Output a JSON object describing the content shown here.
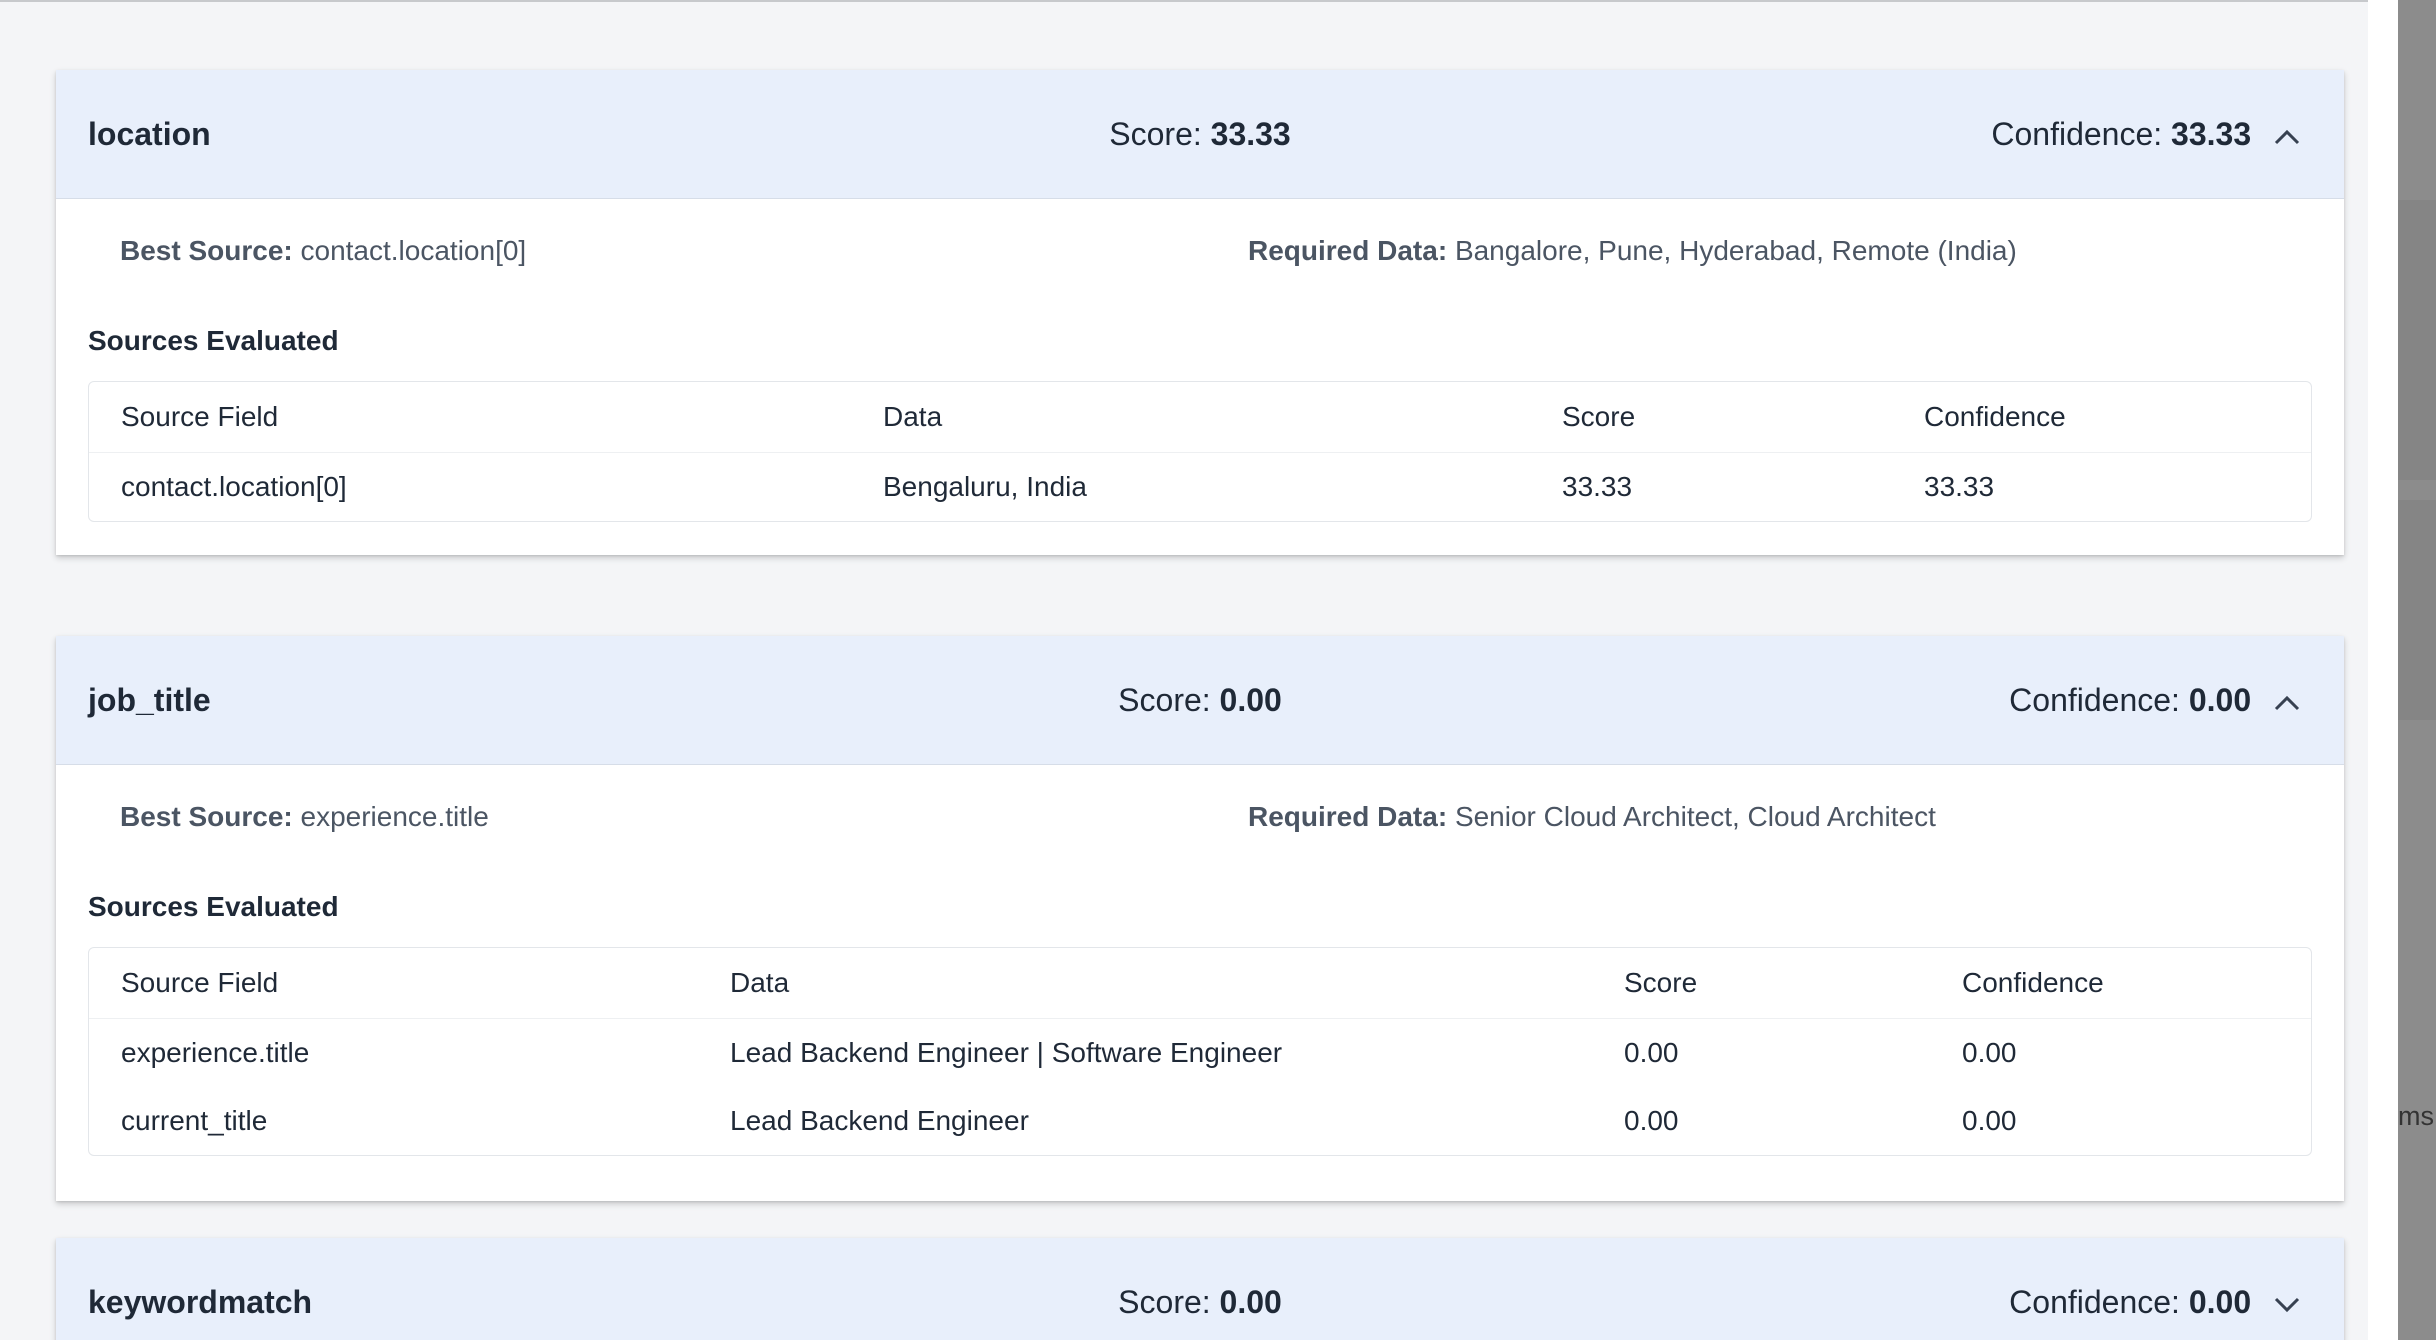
{
  "cards": [
    {
      "title": "location",
      "score_label": "Score:",
      "score_value": "33.33",
      "confidence_label": "Confidence:",
      "confidence_value": "33.33",
      "expanded": true,
      "best_source_label": "Best Source:",
      "best_source_value": "contact.location[0]",
      "required_label": "Required Data:",
      "required_value": "Bangalore, Pune, Hyderabad, Remote (India)",
      "sources_label": "Sources Evaluated",
      "columns": [
        "Source Field",
        "Data",
        "Score",
        "Confidence"
      ],
      "rows": [
        [
          "contact.location[0]",
          "Bengaluru, India",
          "33.33",
          "33.33"
        ]
      ]
    },
    {
      "title": "job_title",
      "score_label": "Score:",
      "score_value": "0.00",
      "confidence_label": "Confidence:",
      "confidence_value": "0.00",
      "expanded": true,
      "best_source_label": "Best Source:",
      "best_source_value": "experience.title",
      "required_label": "Required Data:",
      "required_value": "Senior Cloud Architect, Cloud Architect",
      "sources_label": "Sources Evaluated",
      "columns": [
        "Source Field",
        "Data",
        "Score",
        "Confidence"
      ],
      "rows": [
        [
          "experience.title",
          "Lead Backend Engineer | Software Engineer",
          "0.00",
          "0.00"
        ],
        [
          "current_title",
          "Lead Backend Engineer",
          "0.00",
          "0.00"
        ]
      ]
    },
    {
      "title": "keywordmatch",
      "score_label": "Score:",
      "score_value": "0.00",
      "confidence_label": "Confidence:",
      "confidence_value": "0.00",
      "expanded": false
    }
  ],
  "background_text": "ms",
  "colors": {
    "header_bg": "#e8effb",
    "panel_bg": "#f4f5f7",
    "text": "#1f2937",
    "muted": "#4b5563"
  },
  "icons": {
    "expanded": "chevron-up-icon",
    "collapsed": "chevron-down-icon"
  }
}
